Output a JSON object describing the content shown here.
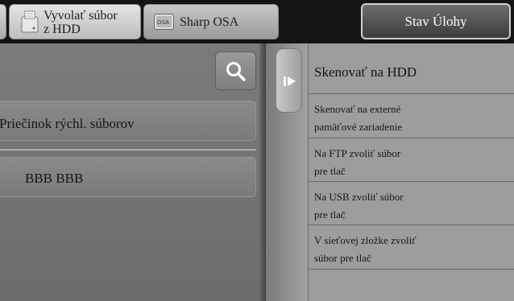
{
  "header": {
    "tabs": [
      {
        "label": "Vyvolať súbor\nz HDD",
        "icon": "hdd-retrieve-icon"
      },
      {
        "label": "Sharp OSA",
        "icon": "sharp-osa-icon"
      }
    ],
    "status_button": "Stav Úlohy"
  },
  "left_panel": {
    "search_icon": "search-icon",
    "rows": [
      {
        "label": "Priečinok rýchl. súborov"
      },
      {
        "label": "BBB BBB"
      }
    ]
  },
  "right_panel": {
    "collapse_icon": "collapse-arrow-icon",
    "menu": [
      {
        "lines": [
          "Skenovať na HDD"
        ]
      },
      {
        "lines": [
          "Skenovať na externé",
          "pamäťové zariadenie"
        ]
      },
      {
        "lines": [
          "Na FTP zvoliť súbor",
          "pre tlač"
        ]
      },
      {
        "lines": [
          "Na USB zvoliť súbor",
          "pre tlač"
        ]
      },
      {
        "lines": [
          "V sieťovej zložke zvoliť",
          "súbor pre tlač"
        ]
      }
    ]
  },
  "colors": {
    "background": "#1b1b1b",
    "panel": "#737373",
    "menu": "#9d9d9d",
    "status_border": "#d0d0d0"
  }
}
